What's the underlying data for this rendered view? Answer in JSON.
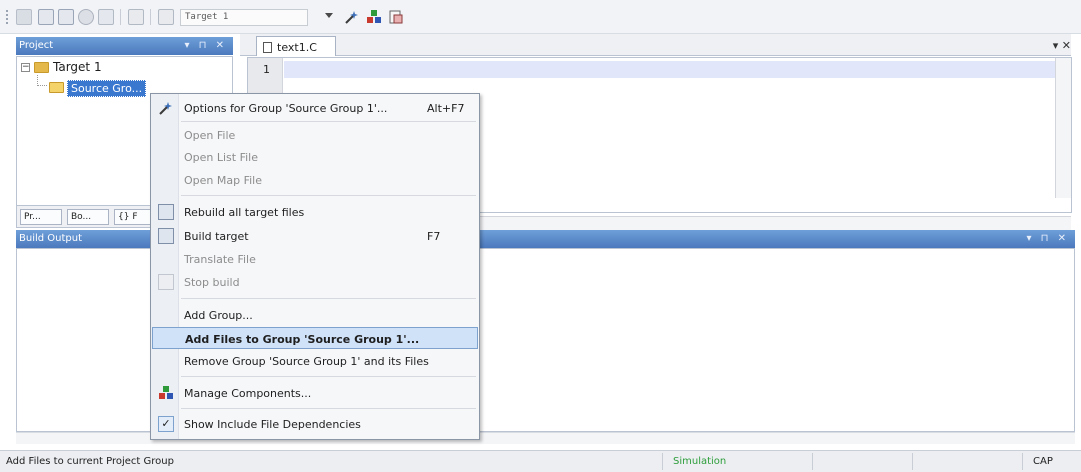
{
  "toolbar": {
    "target_select": "Target 1"
  },
  "project_panel": {
    "title": "Project",
    "controls": "▾ ⊓ ✕",
    "tree": {
      "root": "Target 1",
      "group": "Source Gro..."
    },
    "tabs": [
      "Pr...",
      "Bo...",
      "{} F"
    ]
  },
  "editor": {
    "tab": "text1.C",
    "close": "▾ ✕",
    "line_number": "1"
  },
  "build_output": {
    "title": "Build Output",
    "controls": "▾ ⊓ ✕"
  },
  "context_menu": {
    "items": [
      {
        "label": "Options for Group 'Source Group 1'...",
        "shortcut": "Alt+F7",
        "icon": "options-wand-icon"
      },
      {
        "label": "Open File"
      },
      {
        "label": "Open List File"
      },
      {
        "label": "Open Map File"
      },
      {
        "label": "Rebuild all target files",
        "icon": "rebuild-icon"
      },
      {
        "label": "Build target",
        "shortcut": "F7",
        "icon": "build-icon"
      },
      {
        "label": "Translate File"
      },
      {
        "label": "Stop build",
        "icon": "stop-build-icon"
      },
      {
        "label": "Add Group..."
      },
      {
        "label": "Add Files to Group 'Source Group 1'..."
      },
      {
        "label": "Remove Group 'Source Group 1' and its Files"
      },
      {
        "label": "Manage Components...",
        "icon": "components-icon"
      },
      {
        "label": "Show Include File Dependencies",
        "icon": "checkmark-icon"
      }
    ]
  },
  "statusbar": {
    "message": "Add Files to current Project Group",
    "mode": "Simulation",
    "caps": "CAP"
  }
}
